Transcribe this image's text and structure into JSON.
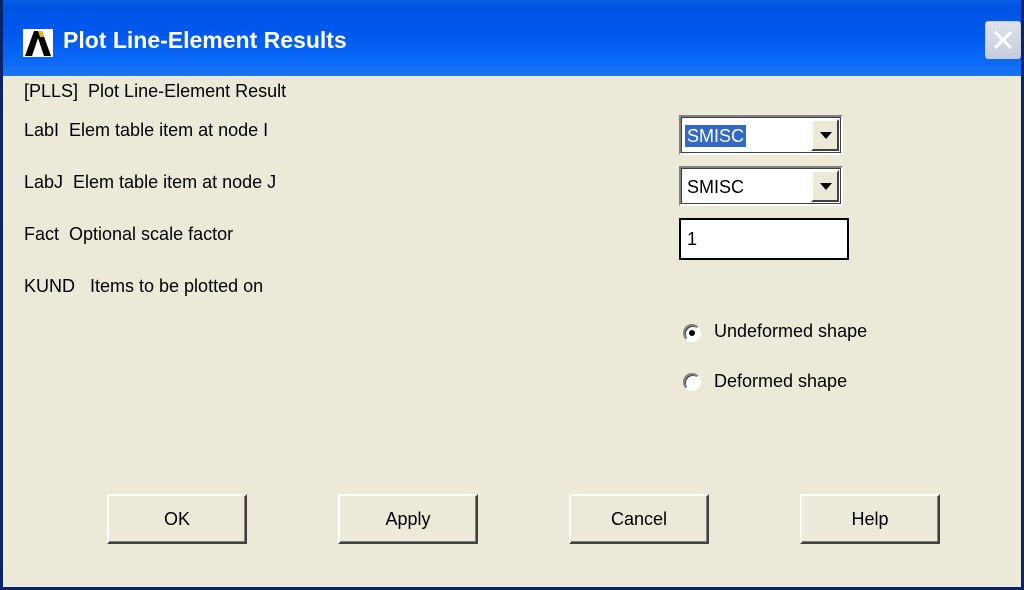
{
  "window": {
    "title": "Plot Line-Element Results"
  },
  "form": {
    "command_heading": "[PLLS]  Plot Line-Element Result",
    "labi": {
      "label": "LabI  Elem table item at node I",
      "value": "SMISC"
    },
    "labj": {
      "label": "LabJ  Elem table item at node J",
      "value": "SMISC"
    },
    "fact": {
      "label": "Fact  Optional scale factor",
      "value": "1"
    },
    "kund": {
      "label": "KUND   Items to be plotted on",
      "options": [
        {
          "label": "Undeformed shape",
          "selected": true
        },
        {
          "label": "Deformed shape",
          "selected": false
        }
      ]
    }
  },
  "buttons": {
    "ok": "OK",
    "apply": "Apply",
    "cancel": "Cancel",
    "help": "Help"
  },
  "colors": {
    "title_bar": "#0058ee",
    "dialog_bg": "#ece9d8",
    "selection": "#316ac5"
  }
}
